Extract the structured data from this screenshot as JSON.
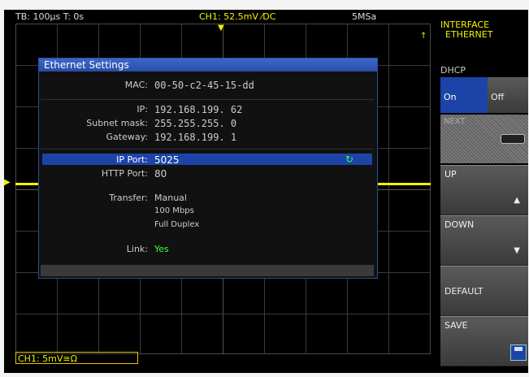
{
  "topbar": {
    "timebase": "TB: 100µs  T: 0s",
    "channel": "CH1: 52.5mV ⁄DC",
    "sample_rate": "5MSa"
  },
  "sidebar": {
    "title_line1": "INTERFACE",
    "title_line2": "ETHERNET",
    "dhcp_label": "DHCP",
    "dhcp_on": "On",
    "dhcp_off": "Off",
    "next_label": "NEXT",
    "up_label": "UP",
    "down_label": "DOWN",
    "default_label": "DEFAULT",
    "save_label": "SAVE"
  },
  "dialog": {
    "title": "Ethernet Settings",
    "mac_label": "MAC:",
    "mac_value": "00-50-c2-45-15-dd",
    "ip_label": "IP:",
    "ip_value": "192.168.199. 62",
    "subnet_label": "Subnet mask:",
    "subnet_value": "255.255.255.  0",
    "gateway_label": "Gateway:",
    "gateway_value": "192.168.199.  1",
    "ipport_label": "IP Port:",
    "ipport_value": "5025",
    "httpport_label": "HTTP Port:",
    "httpport_value": "80",
    "transfer_label": "Transfer:",
    "transfer_mode": "Manual",
    "transfer_speed": "100 Mbps",
    "transfer_duplex": "Full Duplex",
    "link_label": "Link:",
    "link_value": "Yes"
  },
  "footer": {
    "channel_label": "CH1: 5mV≅Ω"
  },
  "colors": {
    "accent_blue": "#1c44a8",
    "trace_yellow": "#f2f200",
    "link_green": "#3dff3d"
  }
}
